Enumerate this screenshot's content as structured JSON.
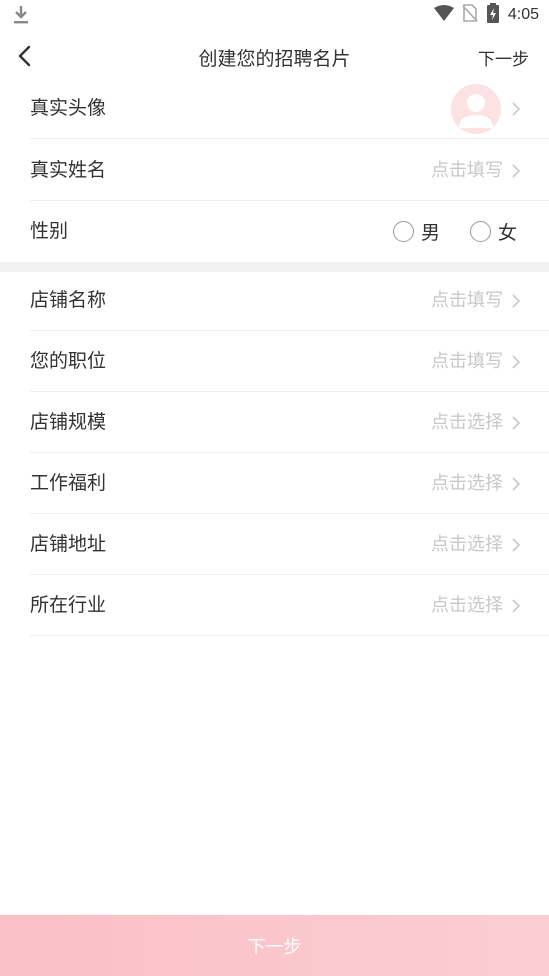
{
  "status_bar": {
    "time": "4:05"
  },
  "header": {
    "title": "创建您的招聘名片",
    "next": "下一步"
  },
  "personal": {
    "avatar_label": "真实头像",
    "name_label": "真实姓名",
    "name_placeholder": "点击填写",
    "gender_label": "性别",
    "gender_options": [
      "男",
      "女"
    ]
  },
  "store": {
    "rows": [
      {
        "label": "店铺名称",
        "value": "点击填写"
      },
      {
        "label": "您的职位",
        "value": "点击填写"
      },
      {
        "label": "店铺规模",
        "value": "点击选择"
      },
      {
        "label": "工作福利",
        "value": "点击选择"
      },
      {
        "label": "店铺地址",
        "value": "点击选择"
      },
      {
        "label": "所在行业",
        "value": "点击选择"
      }
    ]
  },
  "footer": {
    "button": "下一步"
  },
  "colors": {
    "accent": "#f9c0c5",
    "placeholder": "#c8c8c8",
    "avatar_bg": "#fde2e4"
  }
}
